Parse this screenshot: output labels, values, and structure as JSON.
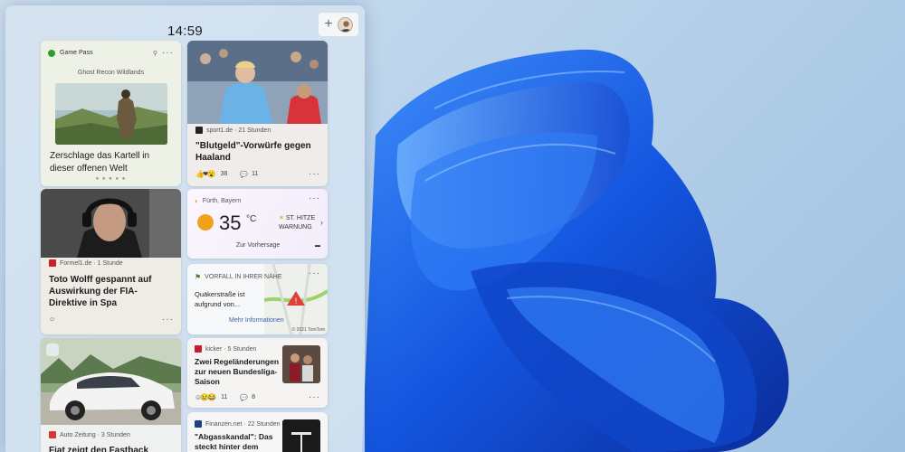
{
  "panel": {
    "clock": "14:59",
    "add_label": "+"
  },
  "cards": {
    "gamepass": {
      "label": "Game Pass",
      "game": "Ghost Recon Wildlands",
      "title": "Zerschlage das Kartell in dieser offenen Welt",
      "dots": "● ● ● ● ●"
    },
    "sport": {
      "source": "sport1.de · 21 Stunden",
      "headline": "\"Blutgeld\"-Vorwürfe gegen Haaland",
      "reactions": "38",
      "comments": "11"
    },
    "wolff": {
      "source": "Formel1.de · 1 Stunde",
      "headline": "Toto Wolff gespannt auf Auswirkung der FIA-Direktive in Spa"
    },
    "weather": {
      "location": "Fürth, Bayern",
      "temp": "35",
      "unit": "°C",
      "warning_line1": "ST. HITZE",
      "warning_line2": "WARNUNG",
      "forecast": "Zur Vorhersage"
    },
    "traffic": {
      "label": "VORFALL IN IHRER NÄHE",
      "text_line1": "Quäkerstraße ist",
      "text_line2": "aufgrund von...",
      "more": "Mehr Informationen",
      "copyright": "© 2021 TomTom"
    },
    "car": {
      "source": "Auto Zeitung · 3 Stunden",
      "headline": "Fiat zeigt den Fastback"
    },
    "kicker": {
      "source": "kicker · 5 Stunden",
      "headline": "Zwei Regeländerungen zur neuen Bundesliga-Saison",
      "reactions": "11",
      "comments": "8"
    },
    "finanzen": {
      "source": "Finanzen.net · 22 Stunden",
      "headline_line1": "\"Abgasskandal\": Das",
      "headline_line2": "steckt hinter dem"
    }
  },
  "icons": {
    "more": "more-icon",
    "pin": "pin-icon",
    "comment": "comment-icon",
    "sun": "sun-icon",
    "incident": "incident-icon"
  },
  "colors": {
    "wallpaper_blue": "#1a5fe0",
    "weather_sun": "#f0a21a",
    "xbox_green": "#2f9e2f",
    "link": "#3a5fa8"
  }
}
